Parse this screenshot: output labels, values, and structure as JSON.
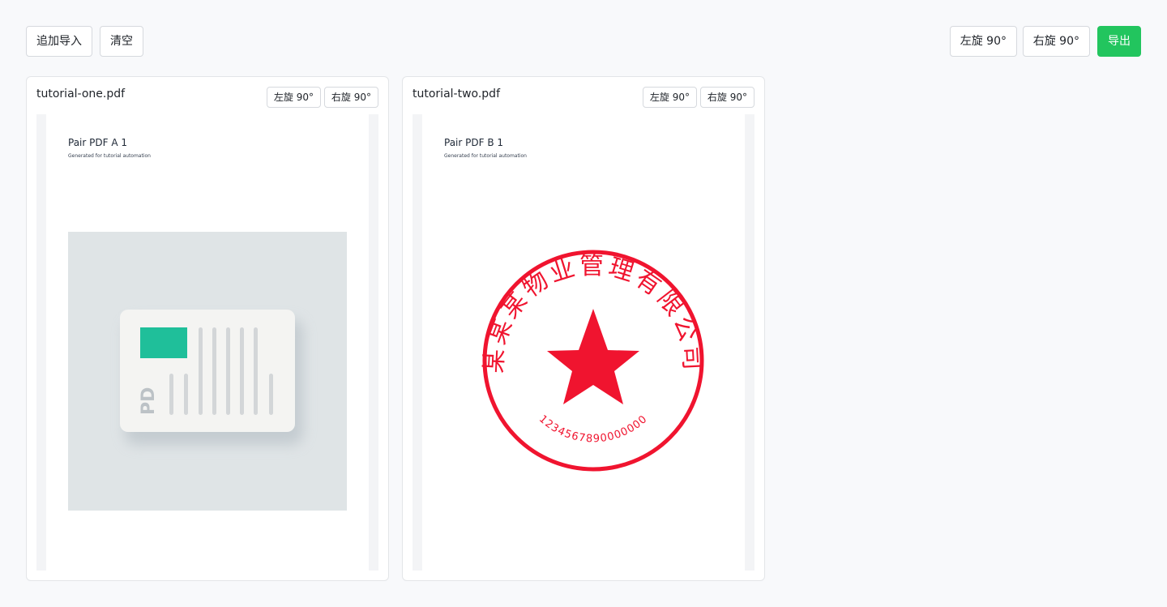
{
  "toolbar": {
    "append_import": "追加导入",
    "clear": "清空",
    "rotate_left": "左旋 90°",
    "rotate_right": "右旋 90°",
    "export": "导出"
  },
  "files": [
    {
      "name": "tutorial-one.pdf",
      "rotate_left": "左旋 90°",
      "rotate_right": "右旋 90°",
      "page_heading": "Pair PDF A 1",
      "page_sub": "Generated for tutorial automation",
      "illustration_text": "PD"
    },
    {
      "name": "tutorial-two.pdf",
      "rotate_left": "左旋 90°",
      "rotate_right": "右旋 90°",
      "page_heading": "Pair PDF B 1",
      "page_sub": "Generated for tutorial automation",
      "seal_text": "某某某物业管理有限公司",
      "seal_number": "1234567890000000"
    }
  ],
  "colors": {
    "accent_green": "#22c55e",
    "seal_red": "#f0142f",
    "illus_teal": "#1fbf9a"
  }
}
